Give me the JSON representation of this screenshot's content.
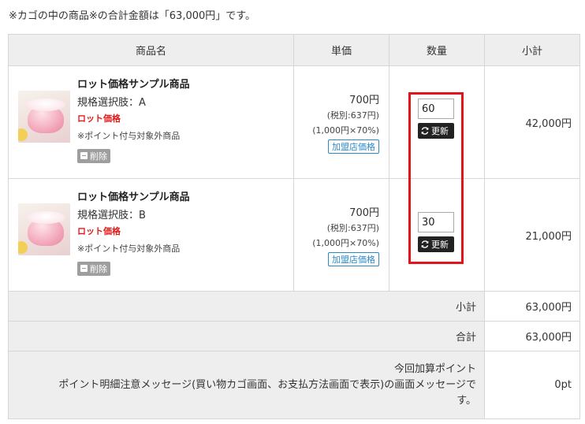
{
  "notice": "※カゴの中の商品※の合計金額は「63,000円」です。",
  "headers": {
    "name": "商品名",
    "price": "単価",
    "qty": "数量",
    "subtotal": "小計"
  },
  "items": [
    {
      "name": "ロット価格サンプル商品",
      "variant": "規格選択肢：A",
      "lot": "ロット価格",
      "note": "※ポイント付与対象外商品",
      "delete": "削除",
      "price": "700円",
      "tax": "(税別:637円)",
      "calc": "(1,000円×70%)",
      "tag": "加盟店価格",
      "qty": "60",
      "update": "更新",
      "subtotal": "42,000円"
    },
    {
      "name": "ロット価格サンプル商品",
      "variant": "規格選択肢：B",
      "lot": "ロット価格",
      "note": "※ポイント付与対象外商品",
      "delete": "削除",
      "price": "700円",
      "tax": "(税別:637円)",
      "calc": "(1,000円×70%)",
      "tag": "加盟店価格",
      "qty": "30",
      "update": "更新",
      "subtotal": "21,000円"
    }
  ],
  "summary": {
    "subtotal_label": "小計",
    "subtotal_value": "63,000円",
    "total_label": "合計",
    "total_value": "63,000円",
    "points_label": "今回加算ポイント",
    "points_message_line1": "ポイント明細注意メッセージ(買い物カゴ画面、お支払方法画面で表示)の画面メッセージで",
    "points_message_line2": "す。",
    "points_value": "0pt"
  },
  "colors": {
    "highlight": "#e3141b",
    "lot": "#e21a1a",
    "tag": "#2b89c8"
  }
}
